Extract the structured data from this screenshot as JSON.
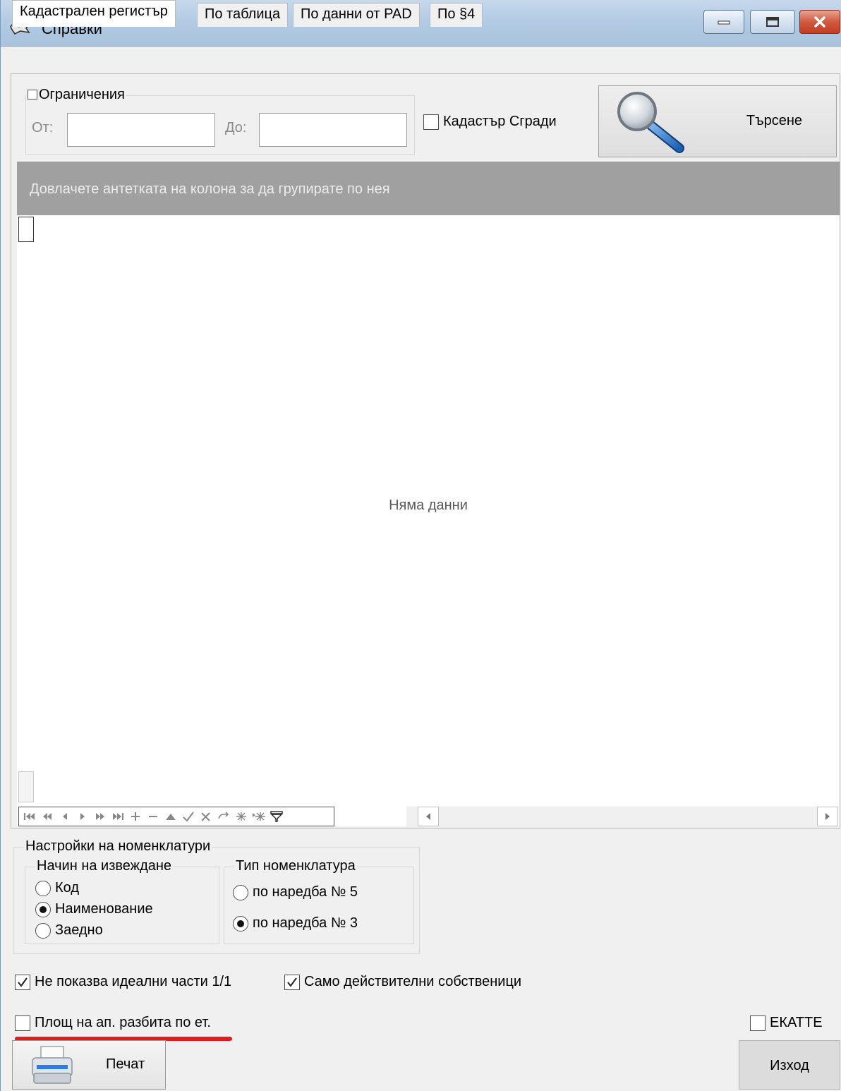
{
  "window": {
    "title": "Справки"
  },
  "tabs": [
    {
      "label": "Кадастрален регистър"
    },
    {
      "label": "По таблица"
    },
    {
      "label": "По данни от PAD"
    },
    {
      "label": "По §4"
    }
  ],
  "limits": {
    "legend": "Ограничения",
    "from_label": "От:",
    "to_label": "До:",
    "from_value": "",
    "to_value": ""
  },
  "cadastre_buildings": {
    "label": "Кадастър Сгради",
    "checked": false
  },
  "search_button": {
    "label": "Търсене"
  },
  "grid": {
    "group_hint": "Довлачете антетката на колона за да групирате по нея",
    "empty_text": "Няма данни"
  },
  "nomenclature": {
    "legend": "Настройки на номенклатури",
    "display_mode": {
      "legend": "Начин на извеждане",
      "options": [
        "Код",
        "Наименование",
        "Заедно"
      ],
      "selected": "Наименование"
    },
    "type": {
      "legend": "Тип номенклатура",
      "options": [
        "по наредба № 5",
        "по наредба № 3"
      ],
      "selected": "по наредба № 3"
    }
  },
  "options": {
    "hide_ideal_parts": {
      "label": "Не показва идеални части 1/1",
      "checked": true
    },
    "only_actual_owners": {
      "label": "Само действителни собственици",
      "checked": true
    },
    "area_by_floor": {
      "label": "Площ на ап. разбита по ет.",
      "checked": false
    },
    "ekatte": {
      "label": "ЕКАТТЕ",
      "checked": false
    }
  },
  "print_button": {
    "label": "Печат"
  },
  "exit_button": {
    "label": "Изход"
  },
  "colors": {
    "highlight_underline": "#e21b1b",
    "group_panel": "#a0a0a0"
  }
}
